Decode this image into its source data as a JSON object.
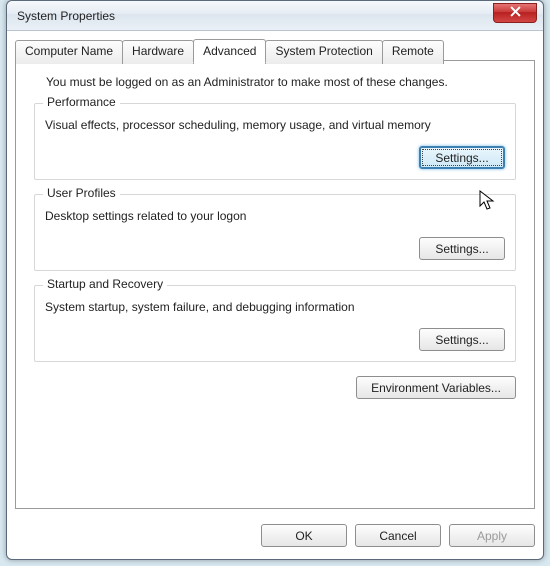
{
  "window": {
    "title": "System Properties"
  },
  "tabs": [
    {
      "label": "Computer Name"
    },
    {
      "label": "Hardware"
    },
    {
      "label": "Advanced"
    },
    {
      "label": "System Protection"
    },
    {
      "label": "Remote"
    }
  ],
  "intro": "You must be logged on as an Administrator to make most of these changes.",
  "groups": {
    "performance": {
      "legend": "Performance",
      "desc": "Visual effects, processor scheduling, memory usage, and virtual memory",
      "button": "Settings..."
    },
    "userprofiles": {
      "legend": "User Profiles",
      "desc": "Desktop settings related to your logon",
      "button": "Settings..."
    },
    "startup": {
      "legend": "Startup and Recovery",
      "desc": "System startup, system failure, and debugging information",
      "button": "Settings..."
    }
  },
  "env_button": "Environment Variables...",
  "dialog_buttons": {
    "ok": "OK",
    "cancel": "Cancel",
    "apply": "Apply"
  }
}
